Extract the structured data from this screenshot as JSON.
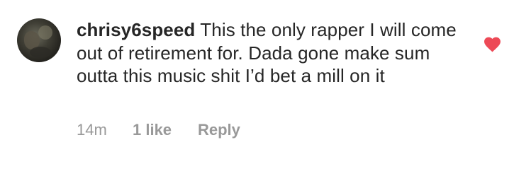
{
  "comment": {
    "username": "chrisy6speed",
    "text": "This the only rapper I will come out of retirement for. Dada gone make sum outta this music shit I’d bet a mill on it",
    "time": "14m",
    "likes": "1 like",
    "reply_label": "Reply",
    "liked": true,
    "heart_icon": "heart-filled-icon",
    "heart_color": "#ed4956"
  }
}
